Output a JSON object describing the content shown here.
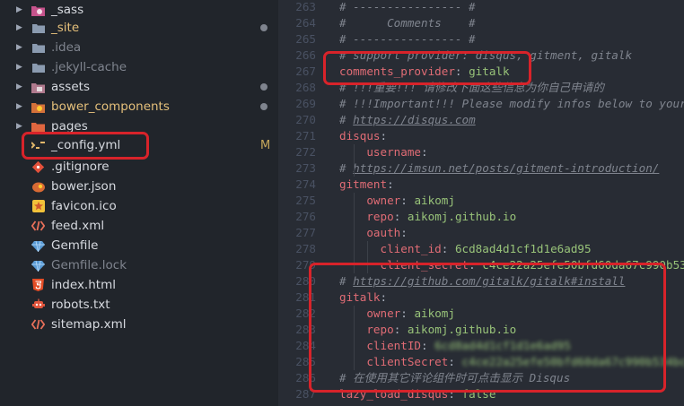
{
  "colors": {
    "sidebar_bg": "#21252b",
    "editor_bg": "#282c34",
    "highlight_box": "#d8232a",
    "comment": "#7f848e",
    "key": "#e06c75",
    "string": "#98c379",
    "modified": "#e5c07b"
  },
  "explorer": {
    "items": [
      {
        "name": "_sass",
        "type": "folder",
        "icon": "sass-folder-icon"
      },
      {
        "name": "_site",
        "type": "folder",
        "icon": "folder-icon",
        "status": "dot"
      },
      {
        "name": ".idea",
        "type": "folder",
        "icon": "folder-icon"
      },
      {
        "name": ".jekyll-cache",
        "type": "folder",
        "icon": "folder-icon"
      },
      {
        "name": "assets",
        "type": "folder",
        "icon": "assets-folder-icon",
        "status": "dot"
      },
      {
        "name": "bower_components",
        "type": "folder",
        "icon": "bower-folder-icon",
        "status": "dot"
      },
      {
        "name": "pages",
        "type": "folder",
        "icon": "pages-folder-icon"
      },
      {
        "name": "_config.yml",
        "type": "file",
        "icon": "yaml-icon",
        "git": "M"
      },
      {
        "name": ".gitignore",
        "type": "file",
        "icon": "git-icon"
      },
      {
        "name": "bower.json",
        "type": "file",
        "icon": "bower-icon"
      },
      {
        "name": "favicon.ico",
        "type": "file",
        "icon": "star-icon"
      },
      {
        "name": "feed.xml",
        "type": "file",
        "icon": "xml-icon"
      },
      {
        "name": "Gemfile",
        "type": "file",
        "icon": "gem-icon"
      },
      {
        "name": "Gemfile.lock",
        "type": "file",
        "icon": "gem-icon"
      },
      {
        "name": "index.html",
        "type": "file",
        "icon": "html5-icon"
      },
      {
        "name": "robots.txt",
        "type": "file",
        "icon": "robot-icon"
      },
      {
        "name": "sitemap.xml",
        "type": "file",
        "icon": "xml-icon"
      }
    ]
  },
  "editor": {
    "lines": [
      {
        "n": "263",
        "text": "# ---------------- #"
      },
      {
        "n": "264",
        "text": "#      Comments    #"
      },
      {
        "n": "265",
        "text": "# ---------------- #"
      },
      {
        "n": "266",
        "text": "# support provider: disqus, gitment, gitalk"
      },
      {
        "n": "267",
        "key": "comments_provider",
        "value": "gitalk"
      },
      {
        "n": "268",
        "text": "# !!!重要!!! 请修改下面这些信息为你自己申请的"
      },
      {
        "n": "269",
        "text": "# !!!Important!!! Please modify infos below to yours"
      },
      {
        "n": "270",
        "text": "# https://disqus.com"
      },
      {
        "n": "271",
        "key": "disqus"
      },
      {
        "n": "272",
        "key": "username"
      },
      {
        "n": "273",
        "text": "# https://imsun.net/posts/gitment-introduction/"
      },
      {
        "n": "274",
        "key": "gitment"
      },
      {
        "n": "275",
        "key": "owner",
        "value": "aikomj"
      },
      {
        "n": "276",
        "key": "repo",
        "value": "aikomj.github.io"
      },
      {
        "n": "277",
        "key": "oauth"
      },
      {
        "n": "278",
        "key": "client_id",
        "value": "6cd8ad4d1cf1d1e6ad95"
      },
      {
        "n": "279",
        "key": "client_secret",
        "value": "c4ce22a25efe50bfd60da67c990b534b"
      },
      {
        "n": "280",
        "text": "# https://github.com/gitalk/gitalk#install"
      },
      {
        "n": "281",
        "key": "gitalk"
      },
      {
        "n": "282",
        "key": "owner",
        "value": "aikomj"
      },
      {
        "n": "283",
        "key": "repo",
        "value": "aikomj.github.io"
      },
      {
        "n": "284",
        "key": "clientID",
        "value": "6cd8ad4d1cf1d1e6ad95"
      },
      {
        "n": "285",
        "key": "clientSecret",
        "value": "c4ce22a25efe50bfd60da67c990b534bc99"
      },
      {
        "n": "286",
        "text": "# 在使用其它评论组件时可点击显示 Disqus"
      },
      {
        "n": "287",
        "key": "lazy_load_disqus",
        "value": "false"
      }
    ]
  }
}
